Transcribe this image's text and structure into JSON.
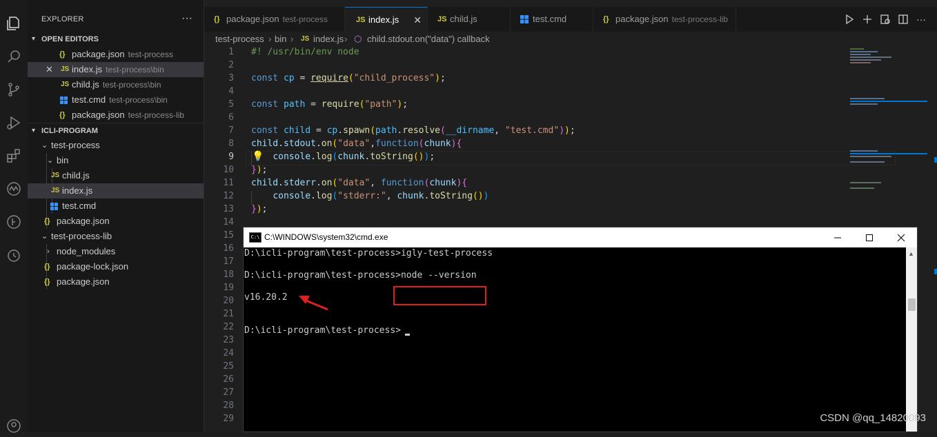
{
  "sidebar": {
    "title": "EXPLORER",
    "more": "···",
    "open_editors": {
      "label": "OPEN EDITORS",
      "items": [
        {
          "icon": "{}",
          "name": "package.json",
          "desc": "test-process"
        },
        {
          "icon": "JS",
          "name": "index.js",
          "desc": "test-process\\bin"
        },
        {
          "icon": "JS",
          "name": "child.js",
          "desc": "test-process\\bin"
        },
        {
          "icon": "windows-icon",
          "name": "test.cmd",
          "desc": "test-process\\bin"
        },
        {
          "icon": "{}",
          "name": "package.json",
          "desc": "test-process-lib"
        }
      ]
    },
    "project": {
      "label": "ICLI-PROGRAM",
      "tree": [
        {
          "name": "test-process"
        },
        {
          "name": "bin"
        },
        {
          "name": "child.js"
        },
        {
          "name": "index.js"
        },
        {
          "name": "test.cmd"
        },
        {
          "name": "package.json"
        },
        {
          "name": "test-process-lib"
        },
        {
          "name": "node_modules"
        },
        {
          "name": "package-lock.json"
        },
        {
          "name": "package.json"
        }
      ]
    }
  },
  "tabs": [
    {
      "name": "package.json",
      "desc": "test-process",
      "icon": "{}"
    },
    {
      "name": "index.js",
      "desc": "",
      "icon": "JS",
      "close": "✕"
    },
    {
      "name": "child.js",
      "desc": "",
      "icon": "JS"
    },
    {
      "name": "test.cmd",
      "desc": "",
      "icon": "windows-icon"
    },
    {
      "name": "package.json",
      "desc": "test-process-lib",
      "icon": "{}"
    }
  ],
  "breadcrumb": [
    "test-process",
    "bin",
    "index.js",
    "child.stdout.on(\"data\") callback"
  ],
  "editor": {
    "line_numbers": [
      "1",
      "2",
      "3",
      "4",
      "5",
      "6",
      "7",
      "8",
      "9",
      "10",
      "11",
      "12",
      "13",
      "14",
      "15",
      "16",
      "17",
      "18",
      "19",
      "20",
      "21",
      "22",
      "23",
      "24",
      "25",
      "26",
      "27",
      "28",
      "29"
    ],
    "current_line": 9
  },
  "cmd": {
    "title": "C:\\WINDOWS\\system32\\cmd.exe",
    "lines": [
      "D:\\icli-program\\test-process>igly-test-process",
      "",
      "D:\\icli-program\\test-process>node --version",
      "",
      "v16.20.2",
      "",
      "",
      "D:\\icli-program\\test-process>"
    ]
  },
  "watermark": "CSDN @qq_14820093",
  "colors": {
    "accent": "#0078d4",
    "highlight": "#e02020"
  }
}
